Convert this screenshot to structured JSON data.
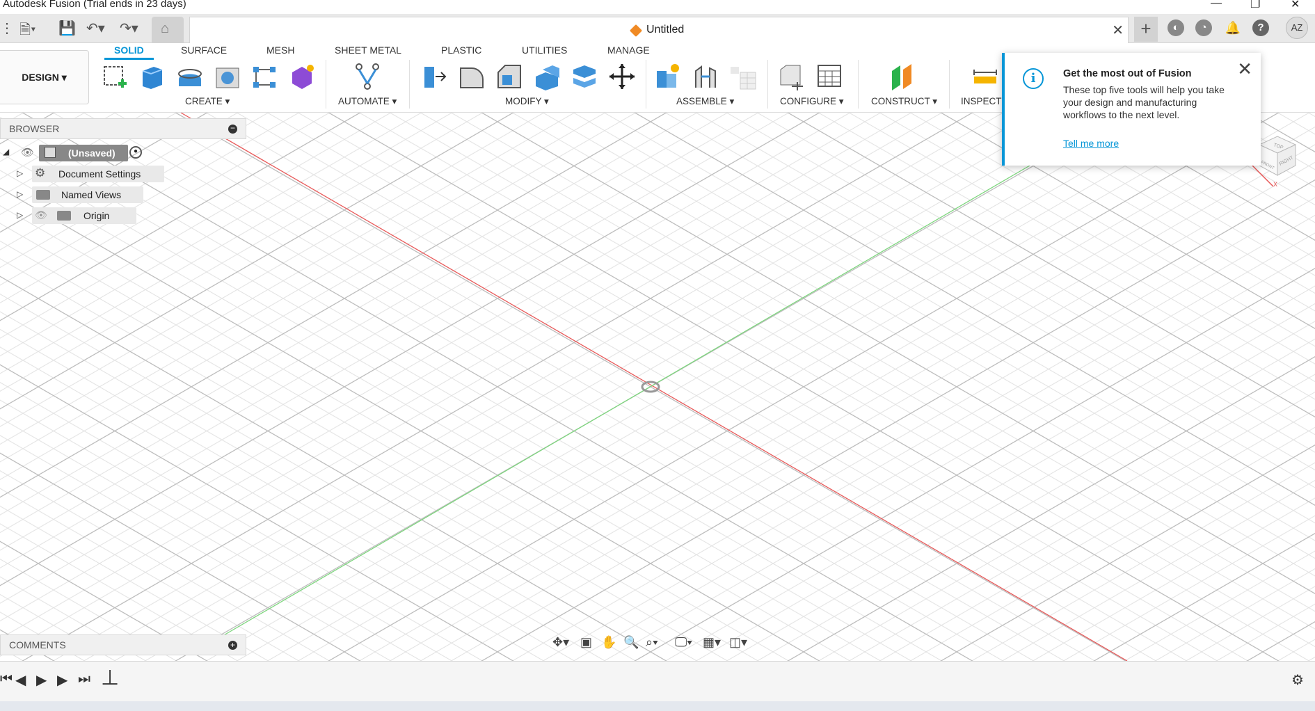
{
  "app": {
    "title": "Autodesk Fusion (Trial ends in 23 days)"
  },
  "document": {
    "name": "Untitled"
  },
  "user": {
    "initials": "AZ"
  },
  "workspace": {
    "label": "DESIGN ▾"
  },
  "tabs": [
    {
      "label": "SOLID"
    },
    {
      "label": "SURFACE"
    },
    {
      "label": "MESH"
    },
    {
      "label": "SHEET METAL"
    },
    {
      "label": "PLASTIC"
    },
    {
      "label": "UTILITIES"
    },
    {
      "label": "MANAGE"
    }
  ],
  "groups": [
    {
      "label": "CREATE ▾"
    },
    {
      "label": "AUTOMATE ▾"
    },
    {
      "label": "MODIFY ▾"
    },
    {
      "label": "ASSEMBLE ▾"
    },
    {
      "label": "CONFIGURE ▾"
    },
    {
      "label": "CONSTRUCT ▾"
    },
    {
      "label": "INSPECT"
    }
  ],
  "browser": {
    "title": "BROWSER",
    "root": "(Unsaved)",
    "items": [
      {
        "label": "Document Settings"
      },
      {
        "label": "Named Views"
      },
      {
        "label": "Origin"
      }
    ]
  },
  "comments": {
    "title": "COMMENTS"
  },
  "popup": {
    "title": "Get the most out of Fusion",
    "body": "These top five tools will help you take your design and manufacturing workflows to the next level.",
    "link": "Tell me more"
  },
  "viewcube": {
    "top": "TOP",
    "right": "RIGHT",
    "front": "FRONT",
    "x_axis": "X"
  },
  "colors": {
    "accent": "#0696d7",
    "x_axis": "#e85a5a",
    "y_axis": "#7ed67e",
    "grid": "#e2e2e2"
  }
}
